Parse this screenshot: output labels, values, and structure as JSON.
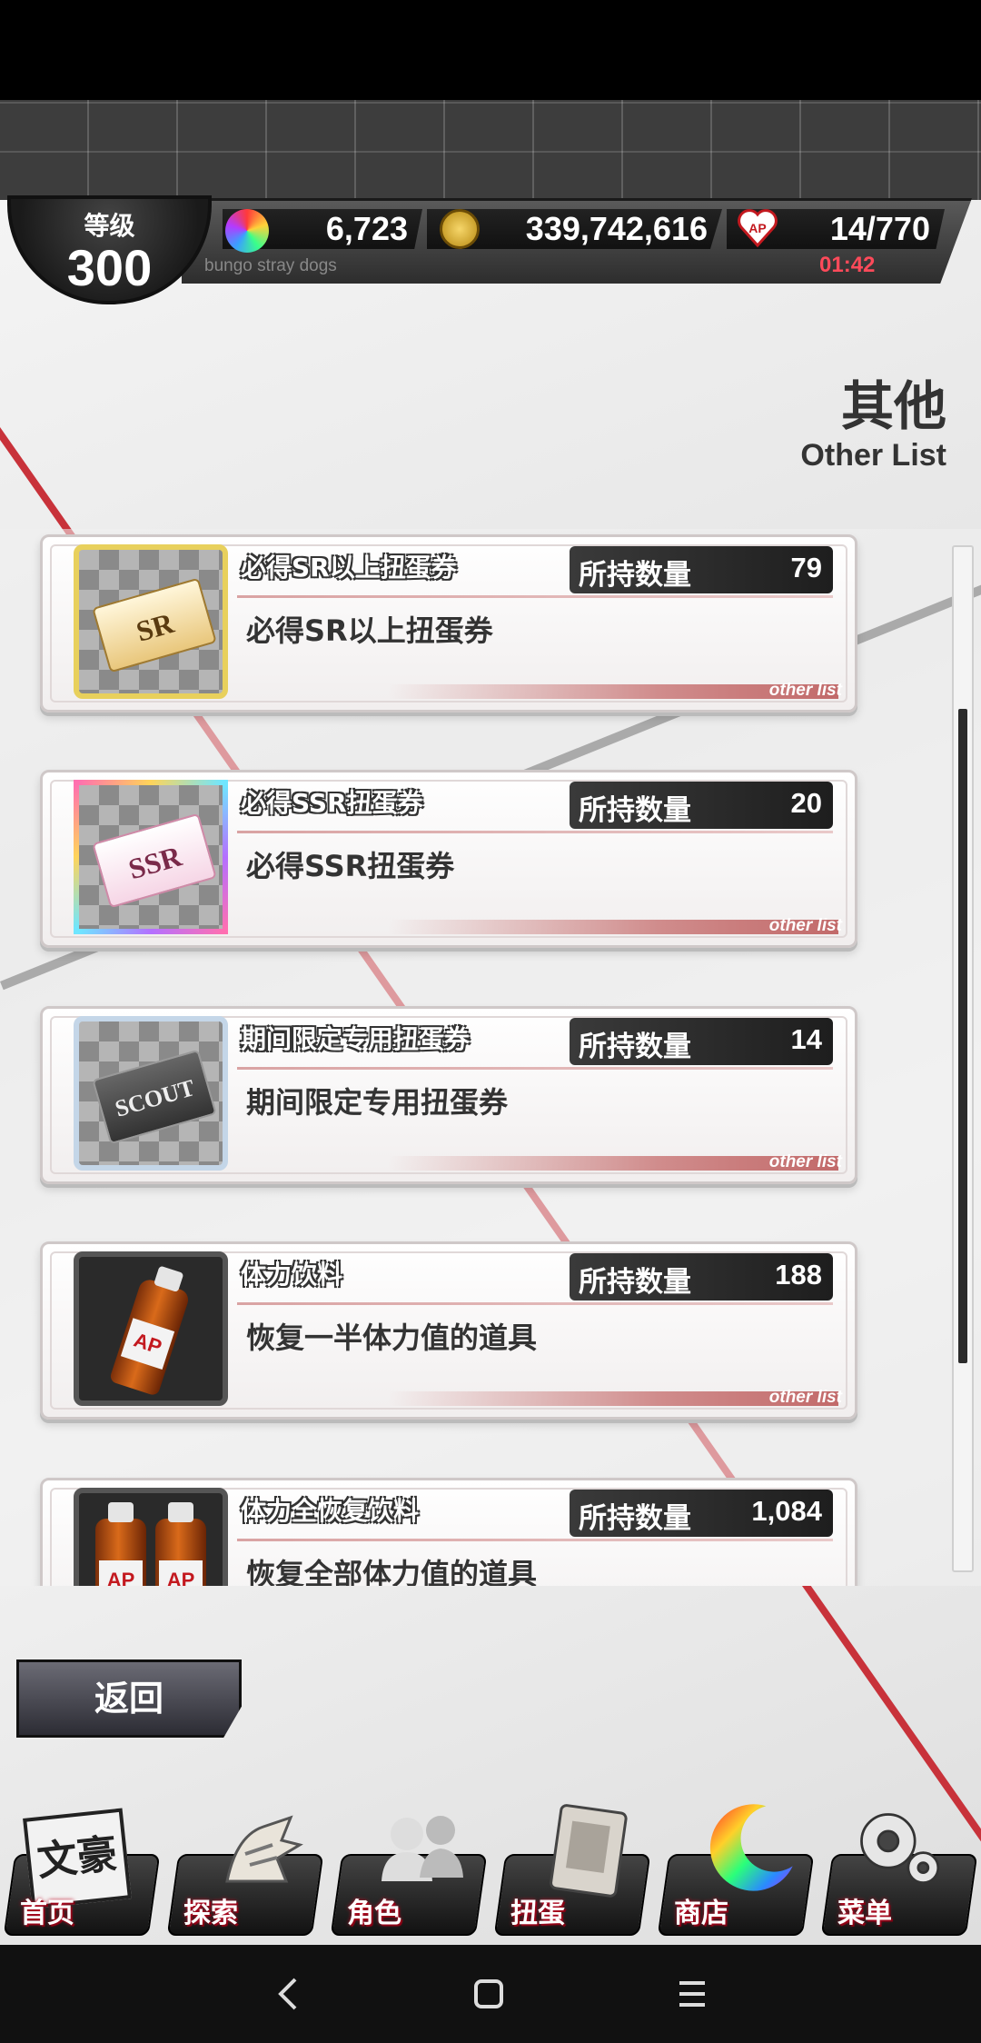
{
  "player": {
    "level_label": "等级",
    "level": "300",
    "game_name": "bungo stray dogs"
  },
  "resources": {
    "crystal": "6,723",
    "coins": "339,742,616",
    "ap": "14/770",
    "ap_timer": "01:42"
  },
  "page": {
    "title": "其他",
    "subtitle": "Other List"
  },
  "items": [
    {
      "name": "必得SR以上扭蛋券",
      "qty_label": "所持数量",
      "qty": "79",
      "desc": "必得SR以上扭蛋券",
      "tag": "other list",
      "ticket_text": "SR"
    },
    {
      "name": "必得SSR扭蛋券",
      "qty_label": "所持数量",
      "qty": "20",
      "desc": "必得SSR扭蛋券",
      "tag": "other list",
      "ticket_text": "SSR"
    },
    {
      "name": "期间限定专用扭蛋券",
      "qty_label": "所持数量",
      "qty": "14",
      "desc": "期间限定专用扭蛋券",
      "tag": "other list",
      "ticket_text": "SCOUT"
    },
    {
      "name": "体力饮料",
      "qty_label": "所持数量",
      "qty": "188",
      "desc": "恢复一半体力值的道具",
      "tag": "other list",
      "bottle_text": "AP"
    },
    {
      "name": "体力全恢复饮料",
      "qty_label": "所持数量",
      "qty": "1,084",
      "desc": "恢复全部体力值的道具",
      "bottle_text": "AP"
    }
  ],
  "back_label": "返回",
  "nav": [
    {
      "label": "首页",
      "icon": "bungo-logo-icon",
      "logo_text": "文豪"
    },
    {
      "label": "探索",
      "icon": "tiger-icon"
    },
    {
      "label": "角色",
      "icon": "people-icon"
    },
    {
      "label": "扭蛋",
      "icon": "book-icon"
    },
    {
      "label": "商店",
      "icon": "crescent-icon"
    },
    {
      "label": "菜单",
      "icon": "gear-icon"
    }
  ],
  "colors": {
    "accent_red": "#c3191f",
    "timer_red": "#ff4a5a",
    "header_dark": "#3d3d3d"
  }
}
